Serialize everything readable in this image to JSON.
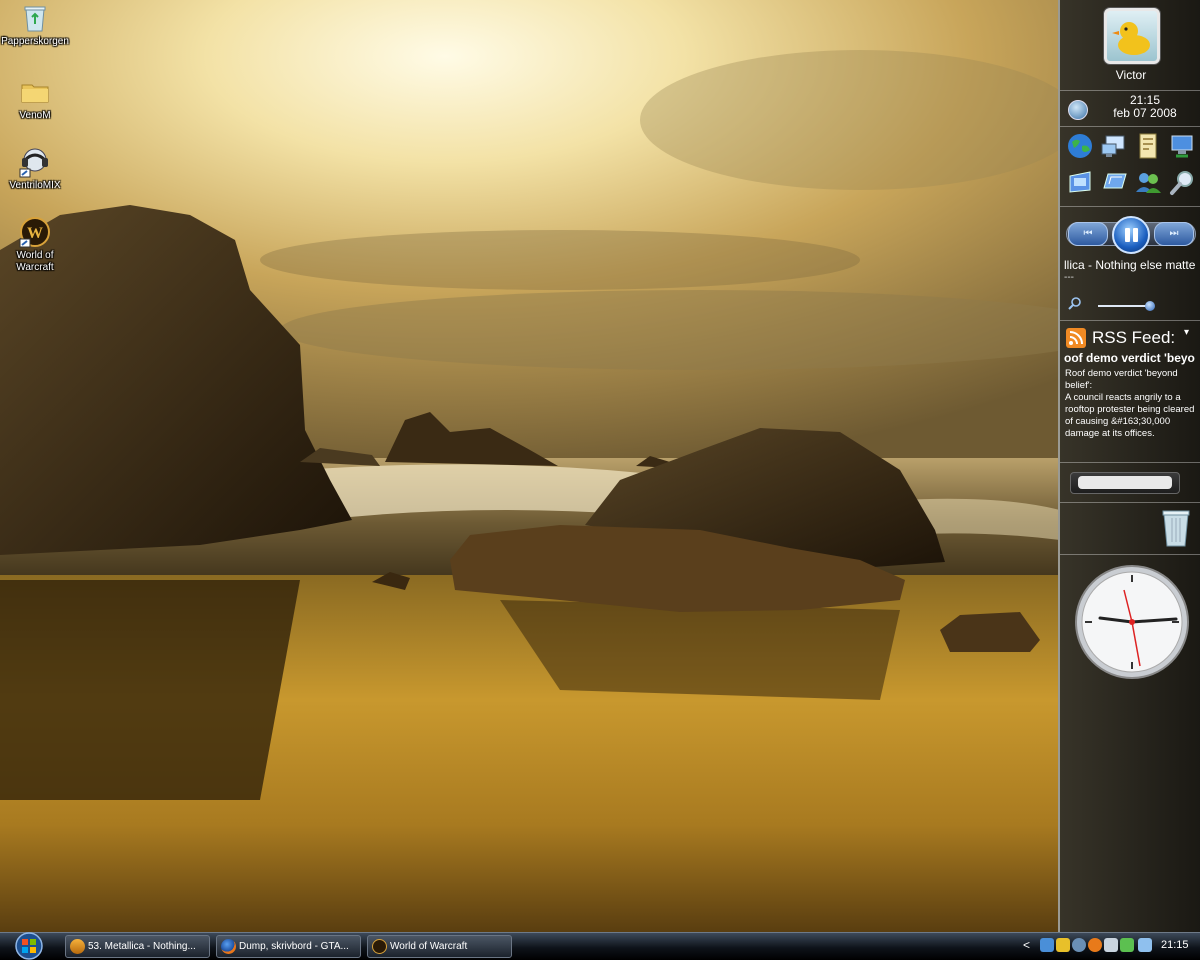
{
  "desktop": {
    "icons": [
      {
        "label": "Papperskorgen",
        "icon": "recycle-bin-icon"
      },
      {
        "label": "VenoM",
        "icon": "folder-icon"
      },
      {
        "label": "VentriloMIX",
        "icon": "ventrilo-icon"
      },
      {
        "label": "World of Warcraft",
        "icon": "world-of-warcraft-icon"
      }
    ]
  },
  "sidebar": {
    "user_name": "Victor",
    "time": "21:15",
    "date": "feb 07 2008",
    "shortcuts": [
      "internet-icon",
      "network-icon",
      "documents-icon",
      "remote-desktop-icon",
      "control-panel-icon",
      "display-icon",
      "users-icon",
      "search-icon"
    ],
    "media": {
      "prev_label": "⏮",
      "next_label": "⏭",
      "track": "llica - Nothing else matte",
      "track_sub": "---"
    },
    "rss": {
      "title": "RSS Feed:",
      "headline": "oof demo verdict 'beyo",
      "body_title": "Roof demo verdict 'beyond belief':",
      "body": "A council reacts angrily to a rooftop protester being cleared of causing &#163;30,000 damage at its offices."
    }
  },
  "taskbar": {
    "tasks": [
      {
        "label": "53. Metallica - Nothing...",
        "icon": "winamp-icon"
      },
      {
        "label": "Dump, skrivbord - GTA...",
        "icon": "firefox-icon"
      },
      {
        "label": "World of Warcraft",
        "icon": "world-of-warcraft-icon"
      }
    ],
    "tray_time": "21:15",
    "tray_arrow": "<"
  },
  "colors": {
    "sky_light": "#f6e9b8",
    "sky_gold": "#c9a24c",
    "water_gold": "#b88a28",
    "rock_dark": "#2a1d0d",
    "sidebar_bg": "#3a362b",
    "taskbar_bg": "#0e131a",
    "rss_orange": "#f08a24"
  }
}
